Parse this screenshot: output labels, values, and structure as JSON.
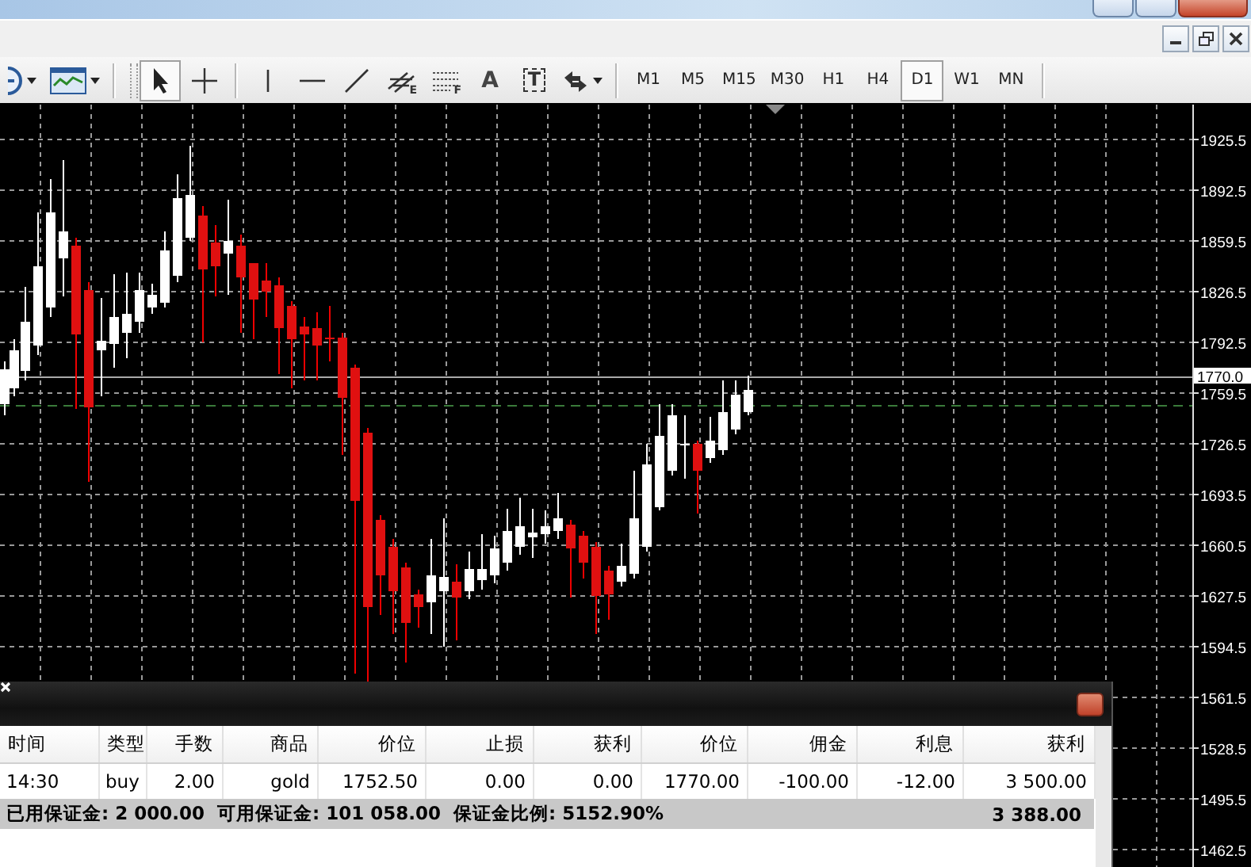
{
  "toolbar": {
    "tools": [
      {
        "kind": "zoom",
        "dropdown": true,
        "selected": false
      },
      {
        "kind": "indicators",
        "dropdown": true,
        "selected": false
      },
      {
        "kind": "cursor",
        "dropdown": false,
        "selected": true
      },
      {
        "kind": "crosshair",
        "dropdown": false,
        "selected": false
      },
      {
        "kind": "vline",
        "dropdown": false,
        "selected": false
      },
      {
        "kind": "hline",
        "dropdown": false,
        "selected": false
      },
      {
        "kind": "trendline",
        "dropdown": false,
        "selected": false
      },
      {
        "kind": "channel",
        "label": "E",
        "dropdown": false,
        "selected": false
      },
      {
        "kind": "fibo",
        "label": "F",
        "dropdown": false,
        "selected": false
      },
      {
        "kind": "text",
        "label": "A",
        "dropdown": false,
        "selected": false
      },
      {
        "kind": "textlabel",
        "label": "T",
        "dropdown": false,
        "selected": false
      },
      {
        "kind": "arrows",
        "dropdown": true,
        "selected": false
      }
    ],
    "periods": [
      {
        "label": "M1",
        "selected": false
      },
      {
        "label": "M5",
        "selected": false
      },
      {
        "label": "M15",
        "selected": false
      },
      {
        "label": "M30",
        "selected": false
      },
      {
        "label": "H1",
        "selected": false
      },
      {
        "label": "H4",
        "selected": false
      },
      {
        "label": "D1",
        "selected": true
      },
      {
        "label": "W1",
        "selected": false
      },
      {
        "label": "MN",
        "selected": false
      }
    ]
  },
  "chart": {
    "price_labels": [
      "1925.5",
      "1892.5",
      "1859.5",
      "1826.5",
      "1792.5",
      "1759.5",
      "1726.5",
      "1693.5",
      "1660.5",
      "1627.5",
      "1594.5",
      "1561.5",
      "1528.5",
      "1495.5",
      "1462.5"
    ],
    "current_price": "1770.0"
  },
  "terminal": {
    "columns": [
      "时间",
      "类型",
      "手数",
      "商品",
      "价位",
      "止损",
      "获利",
      "价位",
      "佣金",
      "利息",
      "获利"
    ],
    "rows": [
      {
        "cells": [
          "14:30",
          "buy",
          "2.00",
          "gold",
          "1752.50",
          "0.00",
          "0.00",
          "1770.00",
          "-100.00",
          "-12.00",
          "3 500.00"
        ]
      }
    ],
    "summary": {
      "text": "已用保证金: 2 000.00  可用保证金: 101 058.00  保证金比例: 5152.90%",
      "total": "3 388.00"
    }
  }
}
